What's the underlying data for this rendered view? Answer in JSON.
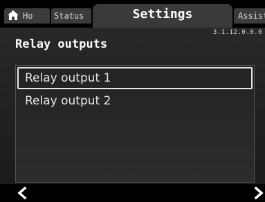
{
  "tabs": {
    "home": "Ho",
    "status": "Status",
    "settings": "Settings",
    "assist": "Assist"
  },
  "version": "3.1.12.0.0.0",
  "page": {
    "title": "Relay outputs"
  },
  "list": {
    "items": [
      {
        "label": "Relay output 1",
        "selected": true
      },
      {
        "label": "Relay output 2",
        "selected": false
      }
    ]
  },
  "icons": {
    "home": "home-icon",
    "back": "chevron-left-icon",
    "forward": "chevron-right-icon"
  },
  "colors": {
    "background": "#000000",
    "panel": "#2a2a2a",
    "tab": "#3c3c3c",
    "active_tab": "#3a3a3a",
    "text": "#ffffff",
    "selection_border": "#e6e6e6"
  }
}
